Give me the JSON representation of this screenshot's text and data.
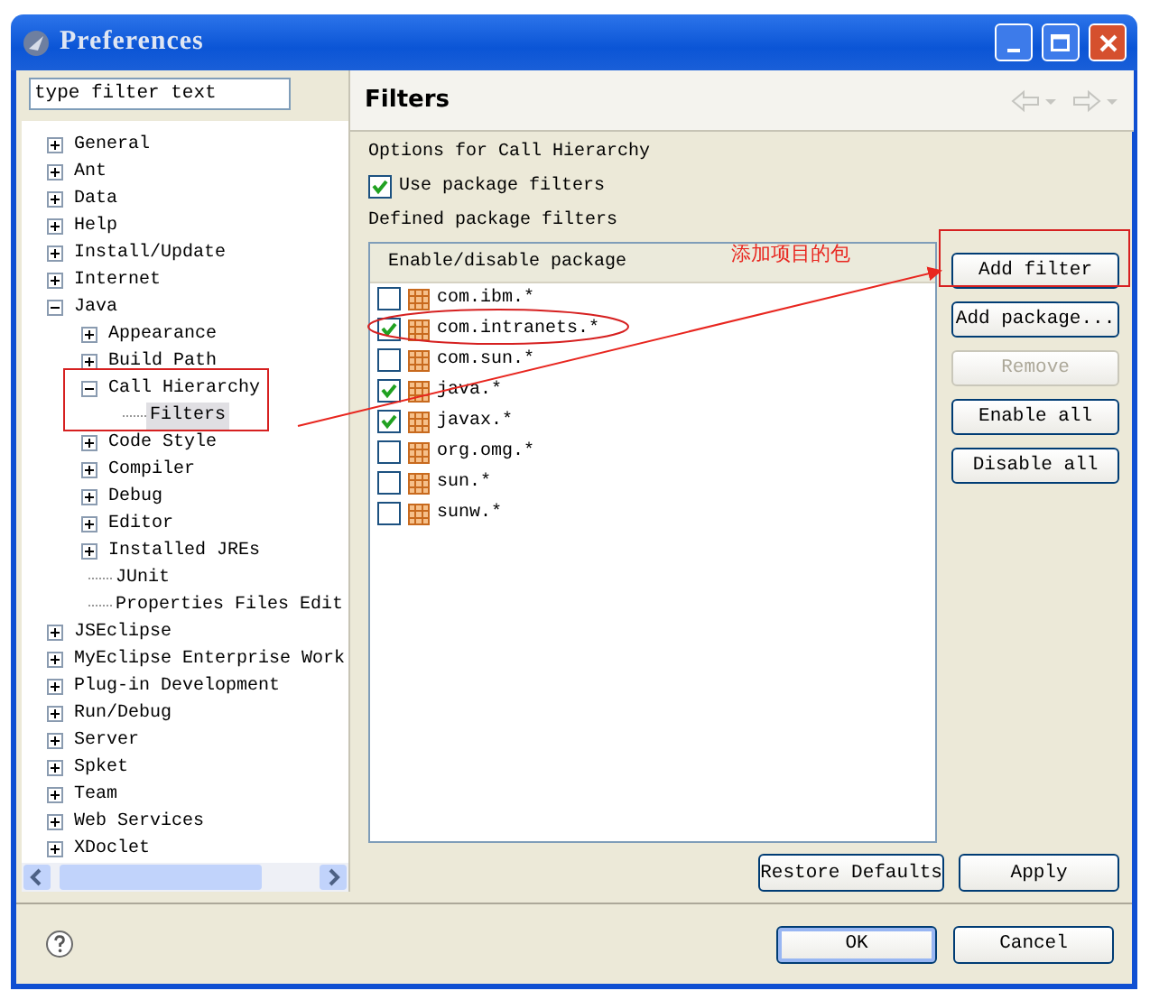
{
  "window": {
    "title": "Preferences"
  },
  "sidebar": {
    "filter": {
      "value": "type filter text"
    },
    "tree": [
      {
        "label": "General",
        "kind": "node",
        "expanded": false,
        "selected": false
      },
      {
        "label": "Ant",
        "kind": "node",
        "expanded": false,
        "selected": false
      },
      {
        "label": "Data",
        "kind": "node",
        "expanded": false,
        "selected": false
      },
      {
        "label": "Help",
        "kind": "node",
        "expanded": false,
        "selected": false
      },
      {
        "label": "Install/Update",
        "kind": "node",
        "expanded": false,
        "selected": false
      },
      {
        "label": "Internet",
        "kind": "node",
        "expanded": false,
        "selected": false
      },
      {
        "label": "Java",
        "kind": "node",
        "expanded": true,
        "selected": false,
        "children": [
          {
            "label": "Appearance",
            "kind": "node",
            "expanded": false,
            "selected": false
          },
          {
            "label": "Build Path",
            "kind": "node",
            "expanded": false,
            "selected": false
          },
          {
            "label": "Call Hierarchy",
            "kind": "node",
            "expanded": true,
            "selected": false,
            "children": [
              {
                "label": "Filters",
                "kind": "leaf",
                "selected": true
              }
            ]
          },
          {
            "label": "Code Style",
            "kind": "node",
            "expanded": false,
            "selected": false
          },
          {
            "label": "Compiler",
            "kind": "node",
            "expanded": false,
            "selected": false
          },
          {
            "label": "Debug",
            "kind": "node",
            "expanded": false,
            "selected": false
          },
          {
            "label": "Editor",
            "kind": "node",
            "expanded": false,
            "selected": false
          },
          {
            "label": "Installed JREs",
            "kind": "node",
            "expanded": false,
            "selected": false
          },
          {
            "label": "JUnit",
            "kind": "leaf",
            "selected": false
          },
          {
            "label": "Properties Files Edit",
            "kind": "leaf",
            "selected": false
          }
        ]
      },
      {
        "label": "JSEclipse",
        "kind": "node",
        "expanded": false,
        "selected": false
      },
      {
        "label": "MyEclipse Enterprise Work",
        "kind": "node",
        "expanded": false,
        "selected": false
      },
      {
        "label": "Plug-in Development",
        "kind": "node",
        "expanded": false,
        "selected": false
      },
      {
        "label": "Run/Debug",
        "kind": "node",
        "expanded": false,
        "selected": false
      },
      {
        "label": "Server",
        "kind": "node",
        "expanded": false,
        "selected": false
      },
      {
        "label": "Spket",
        "kind": "node",
        "expanded": false,
        "selected": false
      },
      {
        "label": "Team",
        "kind": "node",
        "expanded": false,
        "selected": false
      },
      {
        "label": "Web Services",
        "kind": "node",
        "expanded": false,
        "selected": false
      },
      {
        "label": "XDoclet",
        "kind": "node",
        "expanded": false,
        "selected": false
      }
    ]
  },
  "page": {
    "title": "Filters",
    "description": "Options for Call Hierarchy",
    "use_filters": {
      "label": "Use package filters",
      "checked": true
    },
    "list_label": "Defined package filters",
    "table": {
      "column": "Enable/disable package",
      "rows": [
        {
          "label": "com.ibm.*",
          "checked": false
        },
        {
          "label": "com.intranets.*",
          "checked": true
        },
        {
          "label": "com.sun.*",
          "checked": false
        },
        {
          "label": "java.*",
          "checked": true
        },
        {
          "label": "javax.*",
          "checked": true
        },
        {
          "label": "org.omg.*",
          "checked": false
        },
        {
          "label": "sun.*",
          "checked": false
        },
        {
          "label": "sunw.*",
          "checked": false
        }
      ]
    },
    "buttons": [
      {
        "label": "Add filter",
        "disabled": false
      },
      {
        "label": "Add package...",
        "disabled": false
      },
      {
        "label": "Remove",
        "disabled": true
      },
      {
        "label": "Enable all",
        "disabled": false
      },
      {
        "label": "Disable all",
        "disabled": false
      }
    ],
    "footer_buttons": [
      {
        "label": "Restore Defaults"
      },
      {
        "label": "Apply"
      }
    ]
  },
  "dialog_buttons": [
    {
      "label": "OK",
      "default": true
    },
    {
      "label": "Cancel",
      "default": false
    }
  ],
  "annotation": {
    "note": "添加项目的包"
  }
}
